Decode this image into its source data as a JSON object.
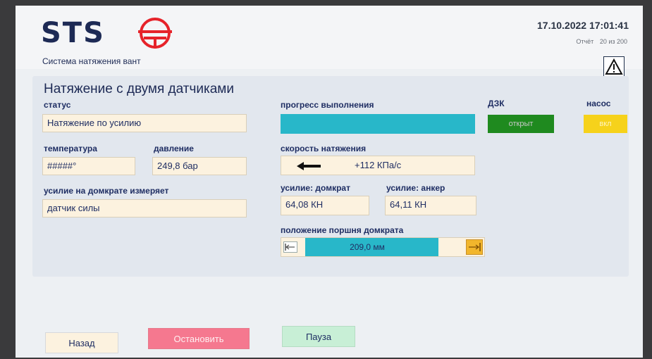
{
  "header": {
    "logo": "STS",
    "subtitle": "Система натяжения вант",
    "datetime": "17.10.2022 17:01:41",
    "report_label": "Отчёт",
    "report_count": "20 из 200",
    "warning_count": "1"
  },
  "main": {
    "title": "Натяжение с двумя датчиками",
    "status_label": "статус",
    "status_value": "Натяжение по усилию",
    "temp_label": "температура",
    "temp_value": "#####°",
    "pressure_label": "давление",
    "pressure_value": "249,8 бар",
    "force_source_label": "усилие на домкрате измеряет",
    "force_source_value": "датчик силы",
    "progress_label": "прогресс выполнения",
    "progress_fraction": 1.0,
    "speed_label": "скорость натяжения",
    "speed_value": "+112 КПа/с",
    "jack_force_label": "усилие: домкрат",
    "jack_force_value": "64,08 КН",
    "anchor_force_label": "усилие: анкер",
    "anchor_force_value": "64,11 КН",
    "piston_label": "положение поршня домкрата",
    "piston_value": "209,0 мм",
    "piston_fraction": 0.82,
    "dzk_label": "ДЗК",
    "dzk_state": "открыт",
    "pump_label": "насос",
    "pump_state": "вкл"
  },
  "buttons": {
    "back": "Назад",
    "stop": "Остановить",
    "pause": "Пауза"
  },
  "colors": {
    "accent": "#28b7c9",
    "dzk_open": "#1f8a1f",
    "pump_on": "#f6d21b",
    "stop": "#f5788f",
    "pause": "#c8efd6",
    "logo_red": "#e6232a",
    "text_navy": "#1f2e63"
  },
  "icons": {
    "logo_mark": "sts-red-logo-icon",
    "warning": "warning-triangle-icon",
    "speed_arrow": "arrow-left-icon",
    "piston_left": "retract-icon",
    "piston_right": "extend-icon"
  }
}
